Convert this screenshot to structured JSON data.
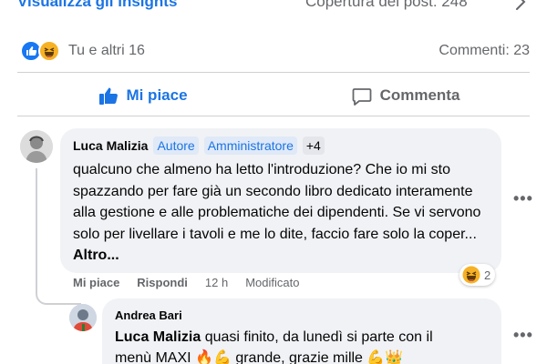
{
  "header": {
    "insights_link": "Visualizza gli insights",
    "reach_text": "Copertura del post: 248"
  },
  "reactions": {
    "reactors_text": "Tu e altri 16",
    "comments_text": "Commenti: 23"
  },
  "actions": {
    "like_label": "Mi piace",
    "comment_label": "Commenta"
  },
  "comment": {
    "author": "Luca Malizia",
    "badges": [
      "Autore",
      "Amministratore"
    ],
    "badges_more": "+4",
    "text": "qualcuno che almeno ha letto l'introduzione? Che io mi sto spazzando per fare già un secondo libro dedicato interamente alla gestione e alle problematiche dei dipendenti. Se vi servono solo per livellare i tavoli e me lo dite, faccio fare solo la coper...",
    "more_label": "Altro...",
    "like_action": "Mi piace",
    "reply_action": "Rispondi",
    "time": "12 h",
    "edited": "Modificato",
    "reaction_count": "2"
  },
  "reply": {
    "author": "Andrea Bari",
    "mention": "Luca Malizia",
    "text_line1": " quasi finito, da lunedì si parte con il",
    "text_line2": "menù MAXI 🔥💪 grande, grazie mille 💪👑"
  },
  "colors": {
    "accent": "#1b74e4",
    "secondary_text": "#65676b",
    "bubble_bg": "#f0f2f5"
  }
}
